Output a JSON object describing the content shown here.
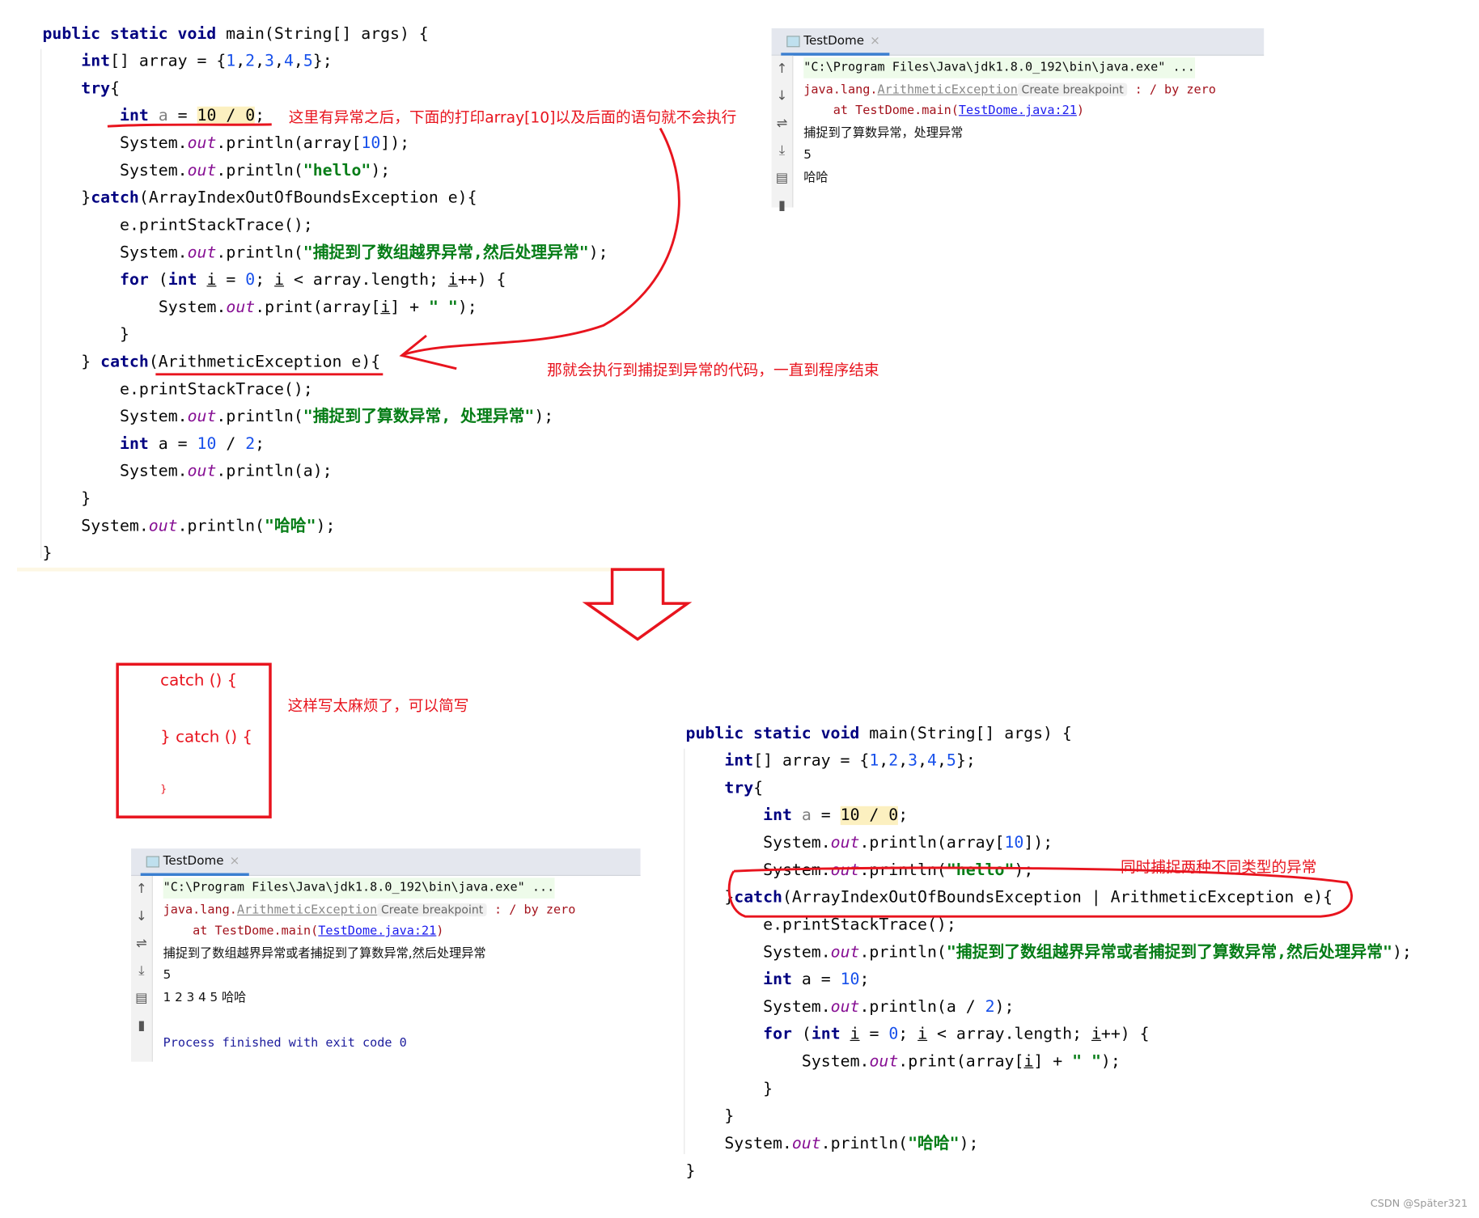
{
  "code_top": {
    "lines": [
      {
        "indent": 0,
        "tokens": [
          [
            "public static void ",
            "k"
          ],
          [
            "main(String[] args) {",
            "p"
          ]
        ]
      },
      {
        "indent": 1,
        "tokens": [
          [
            "int",
            "k"
          ],
          [
            "[] array = {",
            "p"
          ],
          [
            "1",
            "n"
          ],
          [
            ",",
            "p"
          ],
          [
            "2",
            "n"
          ],
          [
            ",",
            "p"
          ],
          [
            "3",
            "n"
          ],
          [
            ",",
            "p"
          ],
          [
            "4",
            "n"
          ],
          [
            ",",
            "p"
          ],
          [
            "5",
            "n"
          ],
          [
            "};",
            "p"
          ]
        ]
      },
      {
        "indent": 1,
        "tokens": [
          [
            "try",
            "k"
          ],
          [
            "{",
            "p"
          ]
        ]
      },
      {
        "indent": 2,
        "tokens": [
          [
            "int ",
            "k"
          ],
          [
            "a",
            "v"
          ],
          [
            " = ",
            "p"
          ],
          [
            "10 / 0",
            "h"
          ],
          [
            ";",
            "p"
          ]
        ]
      },
      {
        "indent": 2,
        "tokens": [
          [
            "System.",
            "p"
          ],
          [
            "out",
            "o"
          ],
          [
            ".println(array[",
            "p"
          ],
          [
            "10",
            "n"
          ],
          [
            "]);",
            "p"
          ]
        ]
      },
      {
        "indent": 2,
        "tokens": [
          [
            "System.",
            "p"
          ],
          [
            "out",
            "o"
          ],
          [
            ".println(",
            "p"
          ],
          [
            "\"hello\"",
            "s"
          ],
          [
            ");",
            "p"
          ]
        ]
      },
      {
        "indent": 1,
        "tokens": [
          [
            "}",
            "p"
          ],
          [
            "catch",
            "k"
          ],
          [
            "(ArrayIndexOutOfBoundsException e){",
            "p"
          ]
        ]
      },
      {
        "indent": 2,
        "tokens": [
          [
            "e.printStackTrace();",
            "p"
          ]
        ]
      },
      {
        "indent": 2,
        "tokens": [
          [
            "System.",
            "p"
          ],
          [
            "out",
            "o"
          ],
          [
            ".println(",
            "p"
          ],
          [
            "\"捕捉到了数组越界异常,然后处理异常\"",
            "s"
          ],
          [
            ");",
            "p"
          ]
        ]
      },
      {
        "indent": 2,
        "tokens": [
          [
            "for ",
            "k"
          ],
          [
            "(",
            "p"
          ],
          [
            "int ",
            "k"
          ],
          [
            "i",
            "u"
          ],
          [
            " = ",
            "p"
          ],
          [
            "0",
            "n"
          ],
          [
            "; ",
            "p"
          ],
          [
            "i",
            "u"
          ],
          [
            " < array.length; ",
            "p"
          ],
          [
            "i",
            "u"
          ],
          [
            "++) {",
            "p"
          ]
        ]
      },
      {
        "indent": 3,
        "tokens": [
          [
            "System.",
            "p"
          ],
          [
            "out",
            "o"
          ],
          [
            ".print(array[",
            "p"
          ],
          [
            "i",
            "u"
          ],
          [
            "] + ",
            "p"
          ],
          [
            "\" \"",
            "s"
          ],
          [
            ");",
            "p"
          ]
        ]
      },
      {
        "indent": 2,
        "tokens": [
          [
            "}",
            "p"
          ]
        ]
      },
      {
        "indent": 1,
        "tokens": [
          [
            "} ",
            "p"
          ],
          [
            "catch",
            "k"
          ],
          [
            "(ArithmeticException e){",
            "p"
          ]
        ]
      },
      {
        "indent": 2,
        "tokens": [
          [
            "e.printStackTrace();",
            "p"
          ]
        ]
      },
      {
        "indent": 2,
        "tokens": [
          [
            "System.",
            "p"
          ],
          [
            "out",
            "o"
          ],
          [
            ".println(",
            "p"
          ],
          [
            "\"捕捉到了算数异常, 处理异常\"",
            "s"
          ],
          [
            ");",
            "p"
          ]
        ]
      },
      {
        "indent": 2,
        "tokens": [
          [
            "int ",
            "k"
          ],
          [
            "a = ",
            "p"
          ],
          [
            "10",
            "n"
          ],
          [
            " / ",
            "p"
          ],
          [
            "2",
            "n"
          ],
          [
            ";",
            "p"
          ]
        ]
      },
      {
        "indent": 2,
        "tokens": [
          [
            "System.",
            "p"
          ],
          [
            "out",
            "o"
          ],
          [
            ".println(a);",
            "p"
          ]
        ]
      },
      {
        "indent": 1,
        "tokens": [
          [
            "}",
            "p"
          ]
        ]
      },
      {
        "indent": 1,
        "tokens": [
          [
            "System.",
            "p"
          ],
          [
            "out",
            "o"
          ],
          [
            ".println(",
            "p"
          ],
          [
            "\"哈哈\"",
            "s"
          ],
          [
            ");",
            "p"
          ]
        ]
      },
      {
        "indent": 0,
        "tokens": [
          [
            "}",
            "p"
          ]
        ]
      }
    ]
  },
  "code_bottom": {
    "lines": [
      {
        "indent": 0,
        "tokens": [
          [
            "public static void ",
            "k"
          ],
          [
            "main(String[] args) {",
            "p"
          ]
        ]
      },
      {
        "indent": 1,
        "tokens": [
          [
            "int",
            "k"
          ],
          [
            "[] array = {",
            "p"
          ],
          [
            "1",
            "n"
          ],
          [
            ",",
            "p"
          ],
          [
            "2",
            "n"
          ],
          [
            ",",
            "p"
          ],
          [
            "3",
            "n"
          ],
          [
            ",",
            "p"
          ],
          [
            "4",
            "n"
          ],
          [
            ",",
            "p"
          ],
          [
            "5",
            "n"
          ],
          [
            "};",
            "p"
          ]
        ]
      },
      {
        "indent": 1,
        "tokens": [
          [
            "try",
            "k"
          ],
          [
            "{",
            "p"
          ]
        ]
      },
      {
        "indent": 2,
        "tokens": [
          [
            "int ",
            "k"
          ],
          [
            "a",
            "v"
          ],
          [
            " = ",
            "p"
          ],
          [
            "10 / 0",
            "h"
          ],
          [
            ";",
            "p"
          ]
        ]
      },
      {
        "indent": 2,
        "tokens": [
          [
            "System.",
            "p"
          ],
          [
            "out",
            "o"
          ],
          [
            ".println(array[",
            "p"
          ],
          [
            "10",
            "n"
          ],
          [
            "]);",
            "p"
          ]
        ]
      },
      {
        "indent": 2,
        "tokens": [
          [
            "System.",
            "p"
          ],
          [
            "out",
            "o"
          ],
          [
            ".println(",
            "p"
          ],
          [
            "\"hello\"",
            "s"
          ],
          [
            ");",
            "p"
          ]
        ]
      },
      {
        "indent": 1,
        "tokens": [
          [
            "}",
            "p"
          ],
          [
            "catch",
            "k"
          ],
          [
            "(ArrayIndexOutOfBoundsException | ArithmeticException e){",
            "p"
          ]
        ]
      },
      {
        "indent": 2,
        "tokens": [
          [
            "e.printStackTrace();",
            "p"
          ]
        ]
      },
      {
        "indent": 2,
        "tokens": [
          [
            "System.",
            "p"
          ],
          [
            "out",
            "o"
          ],
          [
            ".println(",
            "p"
          ],
          [
            "\"捕捉到了数组越界异常或者捕捉到了算数异常,然后处理异常\"",
            "s"
          ],
          [
            ");",
            "p"
          ]
        ]
      },
      {
        "indent": 2,
        "tokens": [
          [
            "int ",
            "k"
          ],
          [
            "a = ",
            "p"
          ],
          [
            "10",
            "n"
          ],
          [
            ";",
            "p"
          ]
        ]
      },
      {
        "indent": 2,
        "tokens": [
          [
            "System.",
            "p"
          ],
          [
            "out",
            "o"
          ],
          [
            ".println(a / ",
            "p"
          ],
          [
            "2",
            "n"
          ],
          [
            ");",
            "p"
          ]
        ]
      },
      {
        "indent": 2,
        "tokens": [
          [
            "for ",
            "k"
          ],
          [
            "(",
            "p"
          ],
          [
            "int ",
            "k"
          ],
          [
            "i",
            "u"
          ],
          [
            " = ",
            "p"
          ],
          [
            "0",
            "n"
          ],
          [
            "; ",
            "p"
          ],
          [
            "i",
            "u"
          ],
          [
            " < array.length; ",
            "p"
          ],
          [
            "i",
            "u"
          ],
          [
            "++) {",
            "p"
          ]
        ]
      },
      {
        "indent": 3,
        "tokens": [
          [
            "System.",
            "p"
          ],
          [
            "out",
            "o"
          ],
          [
            ".print(array[",
            "p"
          ],
          [
            "i",
            "u"
          ],
          [
            "] + ",
            "p"
          ],
          [
            "\" \"",
            "s"
          ],
          [
            ");",
            "p"
          ]
        ]
      },
      {
        "indent": 2,
        "tokens": [
          [
            "}",
            "p"
          ]
        ]
      },
      {
        "indent": 1,
        "tokens": [
          [
            "}",
            "p"
          ]
        ]
      },
      {
        "indent": 1,
        "tokens": [
          [
            "System.",
            "p"
          ],
          [
            "out",
            "o"
          ],
          [
            ".println(",
            "p"
          ],
          [
            "\"哈哈\"",
            "s"
          ],
          [
            ");",
            "p"
          ]
        ]
      },
      {
        "indent": 0,
        "tokens": [
          [
            "}",
            "p"
          ]
        ]
      }
    ]
  },
  "annotations": {
    "note1": "这里有异常之后，下面的打印array[10]以及后面的语句就不会执行",
    "note2": "那就会执行到捕捉到异常的代码，一直到程序结束",
    "note3": "这样写太麻烦了，可以简写",
    "note4": "同时捕捉两种不同类型的异常",
    "box_line1": "catch  () {",
    "box_line2": "} catch  () {",
    "box_line3": "}",
    "accent_color": "#e8141e"
  },
  "console_top": {
    "tab": "TestDome",
    "command": "\"C:\\Program Files\\Java\\jdk1.8.0_192\\bin\\java.exe\" ...",
    "exc_prefix": "java.lang.",
    "exc_name": "ArithmeticException",
    "breakpoint": "Create breakpoint",
    "exc_msg": " : / by zero",
    "at_prefix": "    at TestDome.main(",
    "at_link": "TestDome.java:21",
    "at_suffix": ")",
    "output": [
      "捕捉到了算数异常，处理异常",
      "5",
      "哈哈"
    ]
  },
  "console_bottom": {
    "tab": "TestDome",
    "command": "\"C:\\Program Files\\Java\\jdk1.8.0_192\\bin\\java.exe\" ...",
    "exc_prefix": "java.lang.",
    "exc_name": "ArithmeticException",
    "breakpoint": "Create breakpoint",
    "exc_msg": " : / by zero",
    "at_prefix": "    at TestDome.main(",
    "at_link": "TestDome.java:21",
    "at_suffix": ")",
    "output": [
      "捕捉到了数组越界异常或者捕捉到了算数异常,然后处理异常",
      "5",
      "1 2 3 4 5 哈哈"
    ],
    "process": "Process finished with exit code 0"
  },
  "watermark": "CSDN @Später321"
}
